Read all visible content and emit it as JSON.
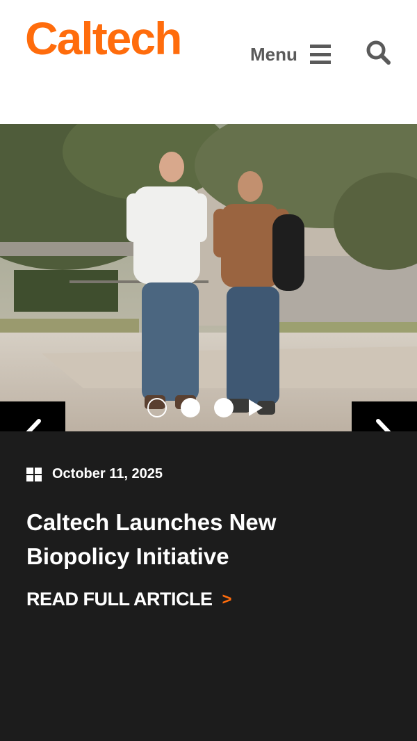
{
  "header": {
    "logo_text": "Caltech",
    "menu_label": "Menu",
    "menu_icon": "hamburger-icon",
    "search_icon": "search-icon",
    "brand_color": "#ff6c0c"
  },
  "carousel": {
    "image_subject": "Two men walking and talking on a campus path",
    "prev_icon": "chevron-left-icon",
    "next_icon": "chevron-right-icon",
    "slide_count": 3,
    "active_slide": 1,
    "play_icon": "play-icon"
  },
  "article": {
    "date_icon": "calendar-icon",
    "date": "October 11, 2025",
    "headline": "Caltech Launches New Biopolicy Initiative",
    "read_more_label": "READ FULL ARTICLE",
    "read_more_arrow": ">",
    "accent_color": "#ff6c0c"
  }
}
